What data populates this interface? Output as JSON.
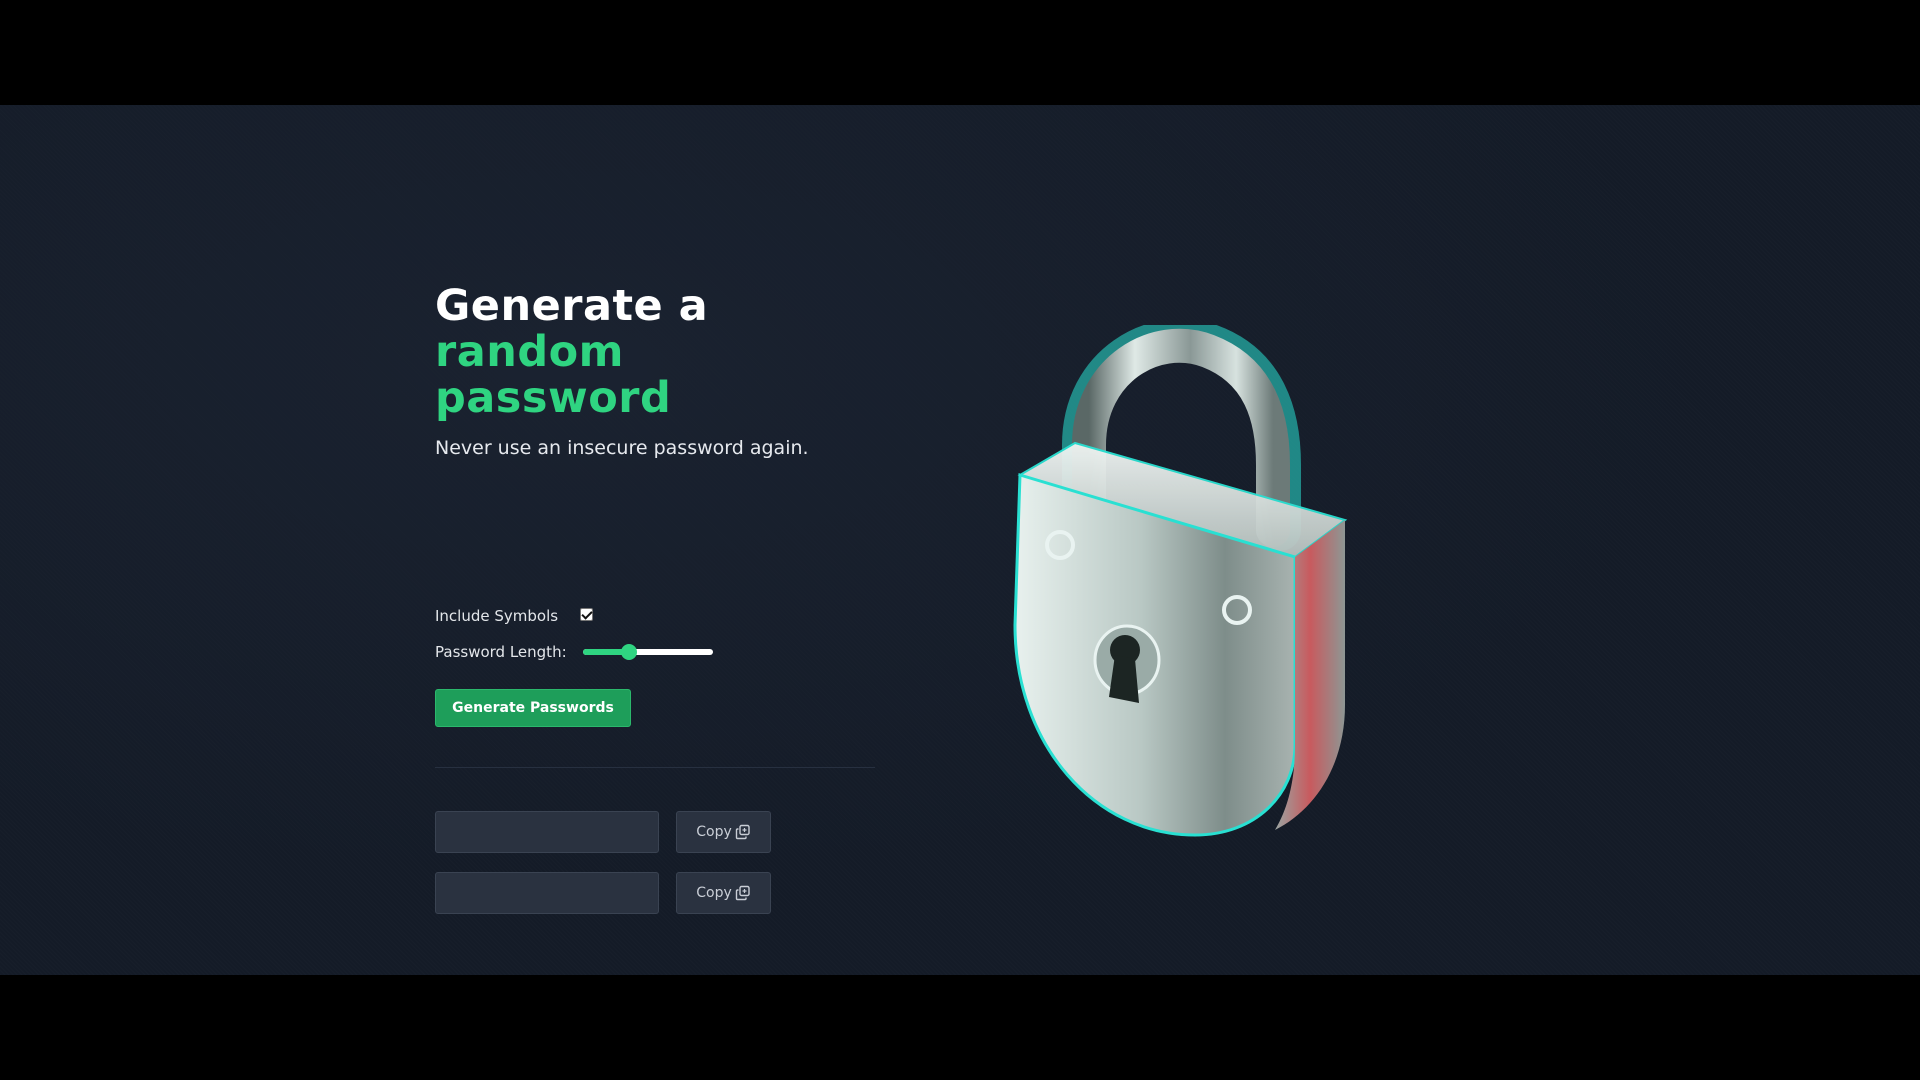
{
  "hero": {
    "title_line1": "Generate a",
    "title_line2": "random password",
    "subtitle": "Never use an insecure password again."
  },
  "options": {
    "include_symbols_label": "Include Symbols",
    "include_symbols_checked": true,
    "password_length_label": "Password Length:",
    "password_length_fraction": 0.36
  },
  "actions": {
    "generate_label": "Generate Passwords"
  },
  "passwords": [
    {
      "value": "",
      "copy_label": "Copy",
      "copy_icon": "copy-icon"
    },
    {
      "value": "",
      "copy_label": "Copy",
      "copy_icon": "copy-icon"
    }
  ],
  "illustration": {
    "icon": "padlock-illustration"
  },
  "colors": {
    "accent": "#2fd481",
    "button": "#1e9e5a",
    "background": "#141b27",
    "field": "#2a3240"
  }
}
